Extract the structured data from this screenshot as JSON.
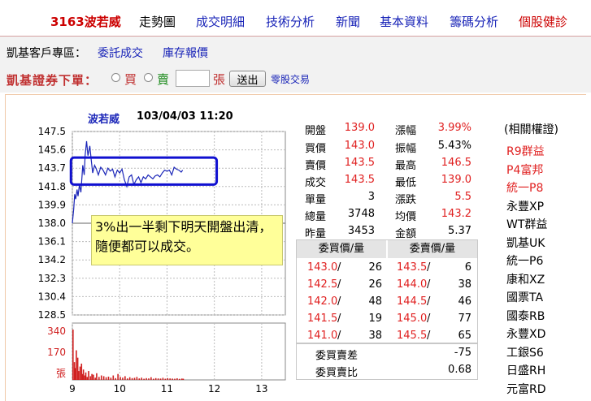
{
  "nav": {
    "stock": "3163波若威",
    "items": [
      {
        "label": "走勢圖",
        "color": "black"
      },
      {
        "label": "成交明細",
        "color": "blue"
      },
      {
        "label": "技術分析",
        "color": "blue"
      },
      {
        "label": "新聞",
        "color": "blue"
      },
      {
        "label": "基本資料",
        "color": "blue"
      },
      {
        "label": "籌碼分析",
        "color": "blue"
      },
      {
        "label": "個股健診",
        "color": "red"
      }
    ]
  },
  "client": {
    "label": "凱基客戶專區：",
    "link1": "委託成交",
    "link2": "庫存報價"
  },
  "order": {
    "title": "凱基證券下單：",
    "buy_label": "買",
    "sell_label": "賣",
    "qty_value": "",
    "unit": "張",
    "send_label": "送出",
    "oddlot_label": "零股交易"
  },
  "chart_data": {
    "type": "line",
    "title": "波若威",
    "timestamp": "103/04/03 11:20",
    "y_ticks": [
      "147.5",
      "145.6",
      "143.7",
      "141.8",
      "139.9",
      "138.0",
      "136.1",
      "134.2",
      "132.3",
      "130.4",
      "128.5"
    ],
    "ylim": [
      128.5,
      147.5
    ],
    "reference": 138.0,
    "x_ticks": [
      "9",
      "10",
      "11",
      "12",
      "13"
    ],
    "xlim": [
      9,
      13.5
    ],
    "volume_ticks": [
      "340",
      "170",
      "張"
    ],
    "volume_max": 340,
    "price": {
      "x": [
        9.0,
        9.03,
        9.05,
        9.07,
        9.1,
        9.12,
        9.15,
        9.18,
        9.2,
        9.22,
        9.25,
        9.27,
        9.3,
        9.33,
        9.37,
        9.4,
        9.43,
        9.47,
        9.5,
        9.55,
        9.6,
        9.65,
        9.7,
        9.75,
        9.8,
        9.85,
        9.9,
        9.95,
        10.0,
        10.05,
        10.1,
        10.15,
        10.2,
        10.25,
        10.3,
        10.35,
        10.4,
        10.45,
        10.5,
        10.55,
        10.6,
        10.65,
        10.7,
        10.75,
        10.8,
        10.85,
        10.9,
        10.95,
        11.0,
        11.05,
        11.1,
        11.15,
        11.2,
        11.25,
        11.3,
        11.33
      ],
      "y": [
        138.0,
        139.5,
        141.0,
        140.5,
        141.5,
        140.8,
        142.0,
        141.2,
        142.5,
        144.0,
        143.0,
        145.0,
        146.5,
        145.0,
        146.0,
        144.5,
        143.2,
        144.0,
        143.7,
        143.0,
        143.8,
        143.5,
        143.0,
        143.7,
        143.4,
        143.6,
        142.8,
        143.5,
        143.2,
        143.6,
        142.5,
        141.8,
        142.8,
        143.0,
        142.0,
        142.5,
        142.8,
        142.2,
        142.8,
        142.6,
        143.0,
        142.8,
        142.6,
        142.9,
        143.0,
        142.8,
        143.2,
        143.5,
        143.4,
        143.5,
        143.0,
        143.8,
        143.6,
        143.5,
        143.3,
        143.5
      ]
    },
    "volume": [
      340,
      120,
      80,
      200,
      150,
      60,
      90,
      110,
      40,
      70,
      30,
      50,
      20,
      60,
      25,
      40,
      35,
      15,
      45,
      20,
      30,
      25,
      18,
      22,
      15,
      30,
      12,
      40,
      20,
      15,
      25,
      10,
      18,
      12,
      14,
      20,
      10,
      15,
      8,
      12,
      10,
      18,
      8,
      12,
      10,
      9,
      14,
      8,
      12,
      10,
      9,
      8,
      11,
      7,
      9,
      8
    ]
  },
  "note": "3%出一半剩下明天開盤出清，隨便都可以成交。",
  "quote": {
    "open_label": "開盤",
    "open": "139.0",
    "bid_label": "買價",
    "bid": "143.0",
    "ask_label": "賣價",
    "ask": "143.5",
    "last_label": "成交",
    "last": "143.5",
    "lot_label": "單量",
    "lot": "3",
    "vol_label": "總量",
    "vol": "3748",
    "prevvol_label": "昨量",
    "prevvol": "3453",
    "chgpct_label": "漲幅",
    "chgpct": "3.99%",
    "amp_label": "振幅",
    "amp": "5.43%",
    "high_label": "最高",
    "high": "146.5",
    "low_label": "最低",
    "low": "139.0",
    "chg_label": "漲跌",
    "chg": "5.5",
    "avg_label": "均價",
    "avg": "143.2",
    "amount_label": "金額",
    "amount": "5.37"
  },
  "orderbook": {
    "bid_header": "委買價/量",
    "ask_header": "委賣價/量",
    "rows": [
      {
        "bp": "143.0",
        "bq": "26",
        "ap": "143.5",
        "aq": "6"
      },
      {
        "bp": "142.5",
        "bq": "26",
        "ap": "144.0",
        "aq": "38"
      },
      {
        "bp": "142.0",
        "bq": "48",
        "ap": "144.5",
        "aq": "46"
      },
      {
        "bp": "141.5",
        "bq": "19",
        "ap": "145.0",
        "aq": "77"
      },
      {
        "bp": "141.0",
        "bq": "38",
        "ap": "145.5",
        "aq": "65"
      }
    ],
    "diff_label": "委買賣差",
    "diff": "-75",
    "ratio_label": "委買賣比",
    "ratio": "0.68"
  },
  "warrants": {
    "title": "(相關權證)",
    "items": [
      {
        "label": "R9群益",
        "color": "red"
      },
      {
        "label": "P4富邦",
        "color": "red"
      },
      {
        "label": "統一P8",
        "color": "red"
      },
      {
        "label": "永豐XP",
        "color": "black"
      },
      {
        "label": "WT群益",
        "color": "black"
      },
      {
        "label": "凱基UK",
        "color": "black"
      },
      {
        "label": "統一P6",
        "color": "black"
      },
      {
        "label": "康和XZ",
        "color": "black"
      },
      {
        "label": "國票TA",
        "color": "black"
      },
      {
        "label": "國泰RB",
        "color": "black"
      },
      {
        "label": "永豐XD",
        "color": "black"
      },
      {
        "label": "工銀S6",
        "color": "black"
      },
      {
        "label": "日盛RH",
        "color": "black"
      },
      {
        "label": "元富RD",
        "color": "black"
      }
    ]
  },
  "colors": {
    "price_line": "#1a25b8",
    "volume_bar": "#d02020",
    "highlight_box": "#1010d0",
    "note_bg": "#ffff99"
  }
}
